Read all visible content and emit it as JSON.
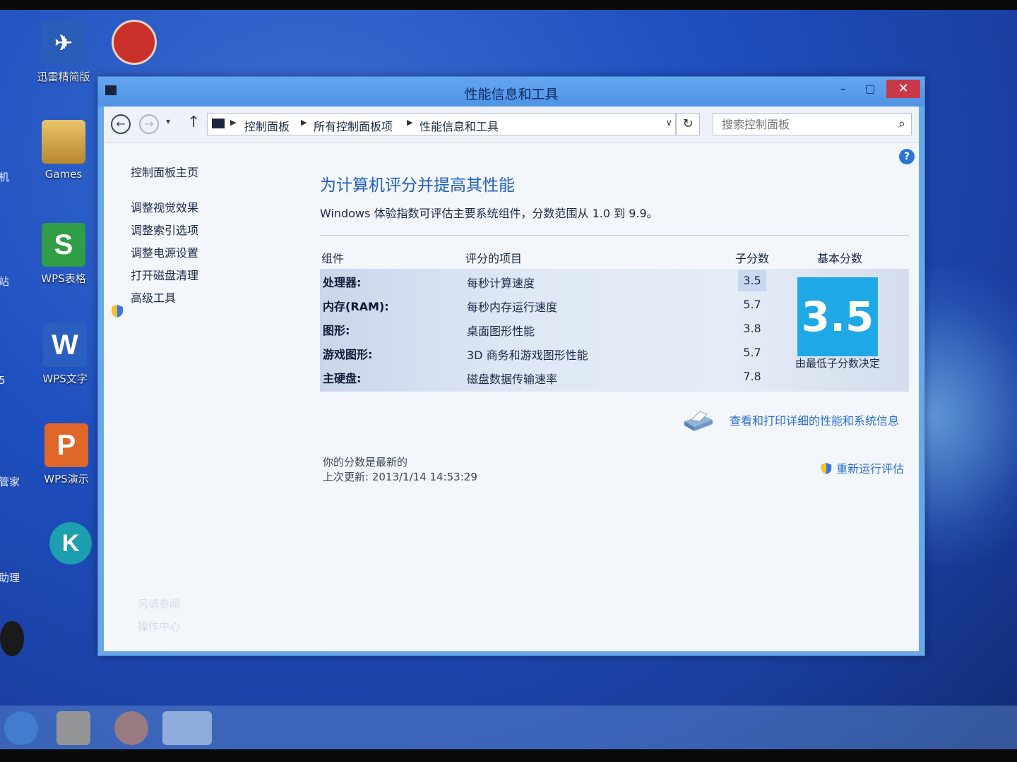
{
  "desktop": {
    "icons": [
      {
        "label": "迅雷精简版",
        "name": "xunlei-icon",
        "color": "#2a5db8"
      },
      {
        "label": "Games",
        "name": "games-folder-icon",
        "color": "#c8a040"
      },
      {
        "label": "WPS表格",
        "name": "wps-sheets-icon",
        "color": "#2f9e44"
      },
      {
        "label": "WPS文字",
        "name": "wps-writer-icon",
        "color": "#2b5fbf"
      },
      {
        "label": "WPS演示",
        "name": "wps-presentation-icon",
        "color": "#e0672a"
      }
    ],
    "left_edge_labels": [
      "机",
      "站",
      "5",
      "管家",
      "助理"
    ],
    "glyphs": {
      "wps_sheets": "S",
      "wps_writer": "W",
      "wps_presentation": "P",
      "k_app": "K"
    }
  },
  "window": {
    "title": "性能信息和工具",
    "caption": {
      "minimize": "–",
      "maximize": "▢",
      "close": "✕"
    }
  },
  "navbar": {
    "back": "←",
    "forward": "→",
    "recent": "▾",
    "up": "↑",
    "breadcrumbs": [
      "控制面板",
      "所有控制面板项",
      "性能信息和工具"
    ],
    "crumb_sep": "▶",
    "dropdown": "∨",
    "refresh": "↻",
    "search_placeholder": "搜索控制面板",
    "search_icon": "⌕",
    "help": "?"
  },
  "leftpane": {
    "home": "控制面板主页",
    "links": [
      "调整视觉效果",
      "调整索引选项",
      "调整电源设置",
      "打开磁盘清理",
      "高级工具"
    ],
    "faint": [
      "另请参阅",
      "操作中心"
    ]
  },
  "main": {
    "title": "为计算机评分并提高其性能",
    "description": "Windows 体验指数可评估主要系统组件，分数范围从 1.0 到 9.9。",
    "headers": {
      "component": "组件",
      "item": "评分的项目",
      "subscore": "子分数",
      "basescore": "基本分数"
    },
    "rows": [
      {
        "component": "处理器:",
        "item": "每秒计算速度",
        "subscore": "3.5"
      },
      {
        "component": "内存(RAM):",
        "item": "每秒内存运行速度",
        "subscore": "5.7"
      },
      {
        "component": "图形:",
        "item": "桌面图形性能",
        "subscore": "3.8"
      },
      {
        "component": "游戏图形:",
        "item": "3D 商务和游戏图形性能",
        "subscore": "5.7"
      },
      {
        "component": "主硬盘:",
        "item": "磁盘数据传输速率",
        "subscore": "7.8"
      }
    ],
    "base_score": "3.5",
    "base_note": "由最低子分数决定",
    "print_link": "查看和打印详细的性能和系统信息",
    "status_line1": "你的分数是最新的",
    "status_line2": "上次更新: 2013/1/14 14:53:29",
    "rerun": "重新运行评估"
  },
  "colors": {
    "accent": "#1f5fbf",
    "link": "#2b6fd0",
    "score_box": "#1ea8e6",
    "close_button": "#c8394a"
  }
}
